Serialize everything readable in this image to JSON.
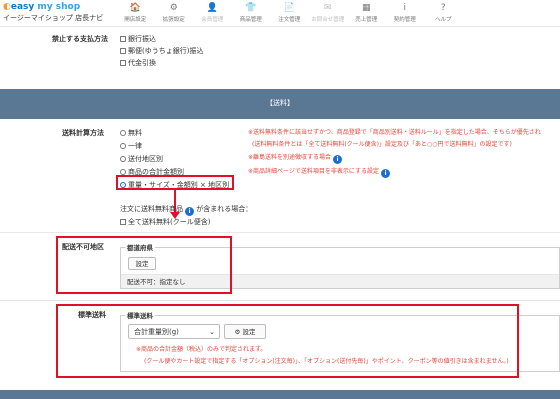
{
  "brand": {
    "name_main": "easy",
    "name_em": "my shop",
    "subtitle": "イージーマイショップ 店長ナビ"
  },
  "nav": [
    {
      "icon": "home-icon",
      "glyph": "🏠",
      "label": "開店設定",
      "dim": false
    },
    {
      "icon": "gear-icon",
      "glyph": "⚙",
      "label": "拡張設定",
      "dim": false
    },
    {
      "icon": "user-icon",
      "glyph": "👤",
      "label": "会員管理",
      "dim": true
    },
    {
      "icon": "shirt-icon",
      "glyph": "👕",
      "label": "商品管理",
      "dim": false
    },
    {
      "icon": "document-icon",
      "glyph": "📄",
      "label": "注文管理",
      "dim": false
    },
    {
      "icon": "mail-icon",
      "glyph": "✉",
      "label": "お問合せ管理",
      "dim": true
    },
    {
      "icon": "calendar-icon",
      "glyph": "▦",
      "label": "売上管理",
      "dim": false
    },
    {
      "icon": "info-icon",
      "glyph": "i",
      "label": "契約管理",
      "dim": false
    },
    {
      "icon": "help-icon",
      "glyph": "?",
      "label": "ヘルプ",
      "dim": false
    }
  ],
  "payment": {
    "label": "禁止する支払方法",
    "options": [
      "銀行振込",
      "郵便(ゆうちょ銀行)振込",
      "代金引換"
    ]
  },
  "shipping_section_title": "【送料】",
  "calc": {
    "label": "送料計算方法",
    "options": [
      "無料",
      "一律",
      "送付地区別",
      "商品の合計金額別",
      "重量・サイズ・金額別 × 地区別"
    ],
    "selected_index": 4,
    "notes": [
      "※送料無料条件に該当せずかつ、商品登録で「商品別送料・送料ルール」を指定した場合、そちらが優先され",
      "(送料無料条件とは「全て送料無料(クール便含)」設定及び「あと○○円で送料無料」の設定です)",
      "※離島送料を別途徴収する場合",
      "※商品詳細ページで送料項目を非表示にする設定"
    ],
    "free_note": "注文に送料無料商品",
    "free_note_suffix": "が含まれる場合：",
    "free_checkbox": "全て送料無料(クール便含)"
  },
  "undeliverable": {
    "label": "配送不可地区",
    "legend": "都道府県",
    "button": "設定",
    "status": "配送不可：指定なし"
  },
  "standard": {
    "label": "標準送料",
    "legend": "標準送料",
    "select_value": "合計重量別(g)",
    "settings_button": "設定",
    "note1": "※商品の合計金額（税込）のみで判定されます。",
    "note2": "(クール便やカート設定で指定する「オプション(注文毎)」、「オプション(送付先毎)」やポイント、クーポン等の値引きは含まれません。)"
  },
  "colors": {
    "accent": "#1a6fd0",
    "band": "#5a7894",
    "highlight": "#e0102a",
    "note": "#e8463a"
  }
}
